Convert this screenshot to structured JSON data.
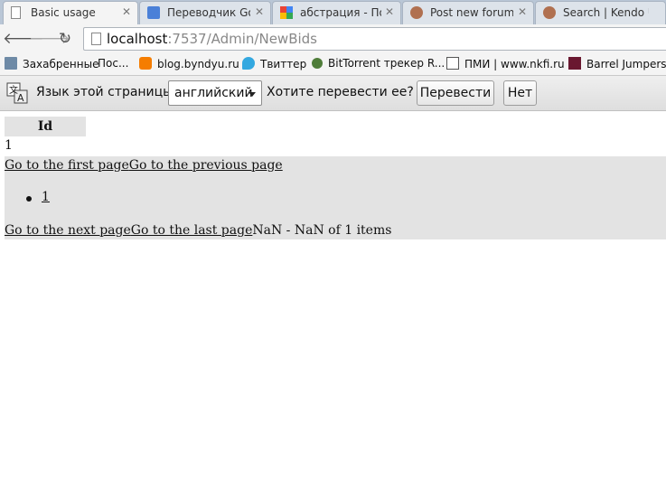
{
  "tabs": [
    {
      "title": "Basic usage",
      "active": true
    },
    {
      "title": "Переводчик Goog"
    },
    {
      "title": "абстрация - Поис"
    },
    {
      "title": "Post new forum th"
    },
    {
      "title": "Search | Kendo UI"
    }
  ],
  "address": {
    "host": "localhost",
    "path": ":7537/Admin/NewBids"
  },
  "bookmarks": [
    {
      "label": "Захабренные"
    },
    {
      "label": "Пос..."
    },
    {
      "label": "blog.byndyu.ru"
    },
    {
      "label": "Твиттер"
    },
    {
      "label": "BitTorrent трекер R..."
    },
    {
      "label": "ПМИ | www.nkfi.ru"
    },
    {
      "label": "Barrel Jumpers |"
    }
  ],
  "translate_bar": {
    "prompt": "Язык этой страницы",
    "language": "английский",
    "question": "Хотите перевести ее?",
    "translate_button": "Перевести",
    "no_button": "Нет"
  },
  "grid": {
    "column_header": "Id",
    "rows": [
      "1"
    ]
  },
  "pager": {
    "first": "Go to the first page",
    "previous": "Go to the previous page",
    "page_number": "1",
    "next": "Go to the next page",
    "last": "Go to the last page",
    "info": "NaN - NaN of 1 items"
  },
  "colors": {
    "tab_strip": "#b9c6d6",
    "toolbar": "#f4f4f4",
    "grid_header": "#e3e3e3"
  }
}
